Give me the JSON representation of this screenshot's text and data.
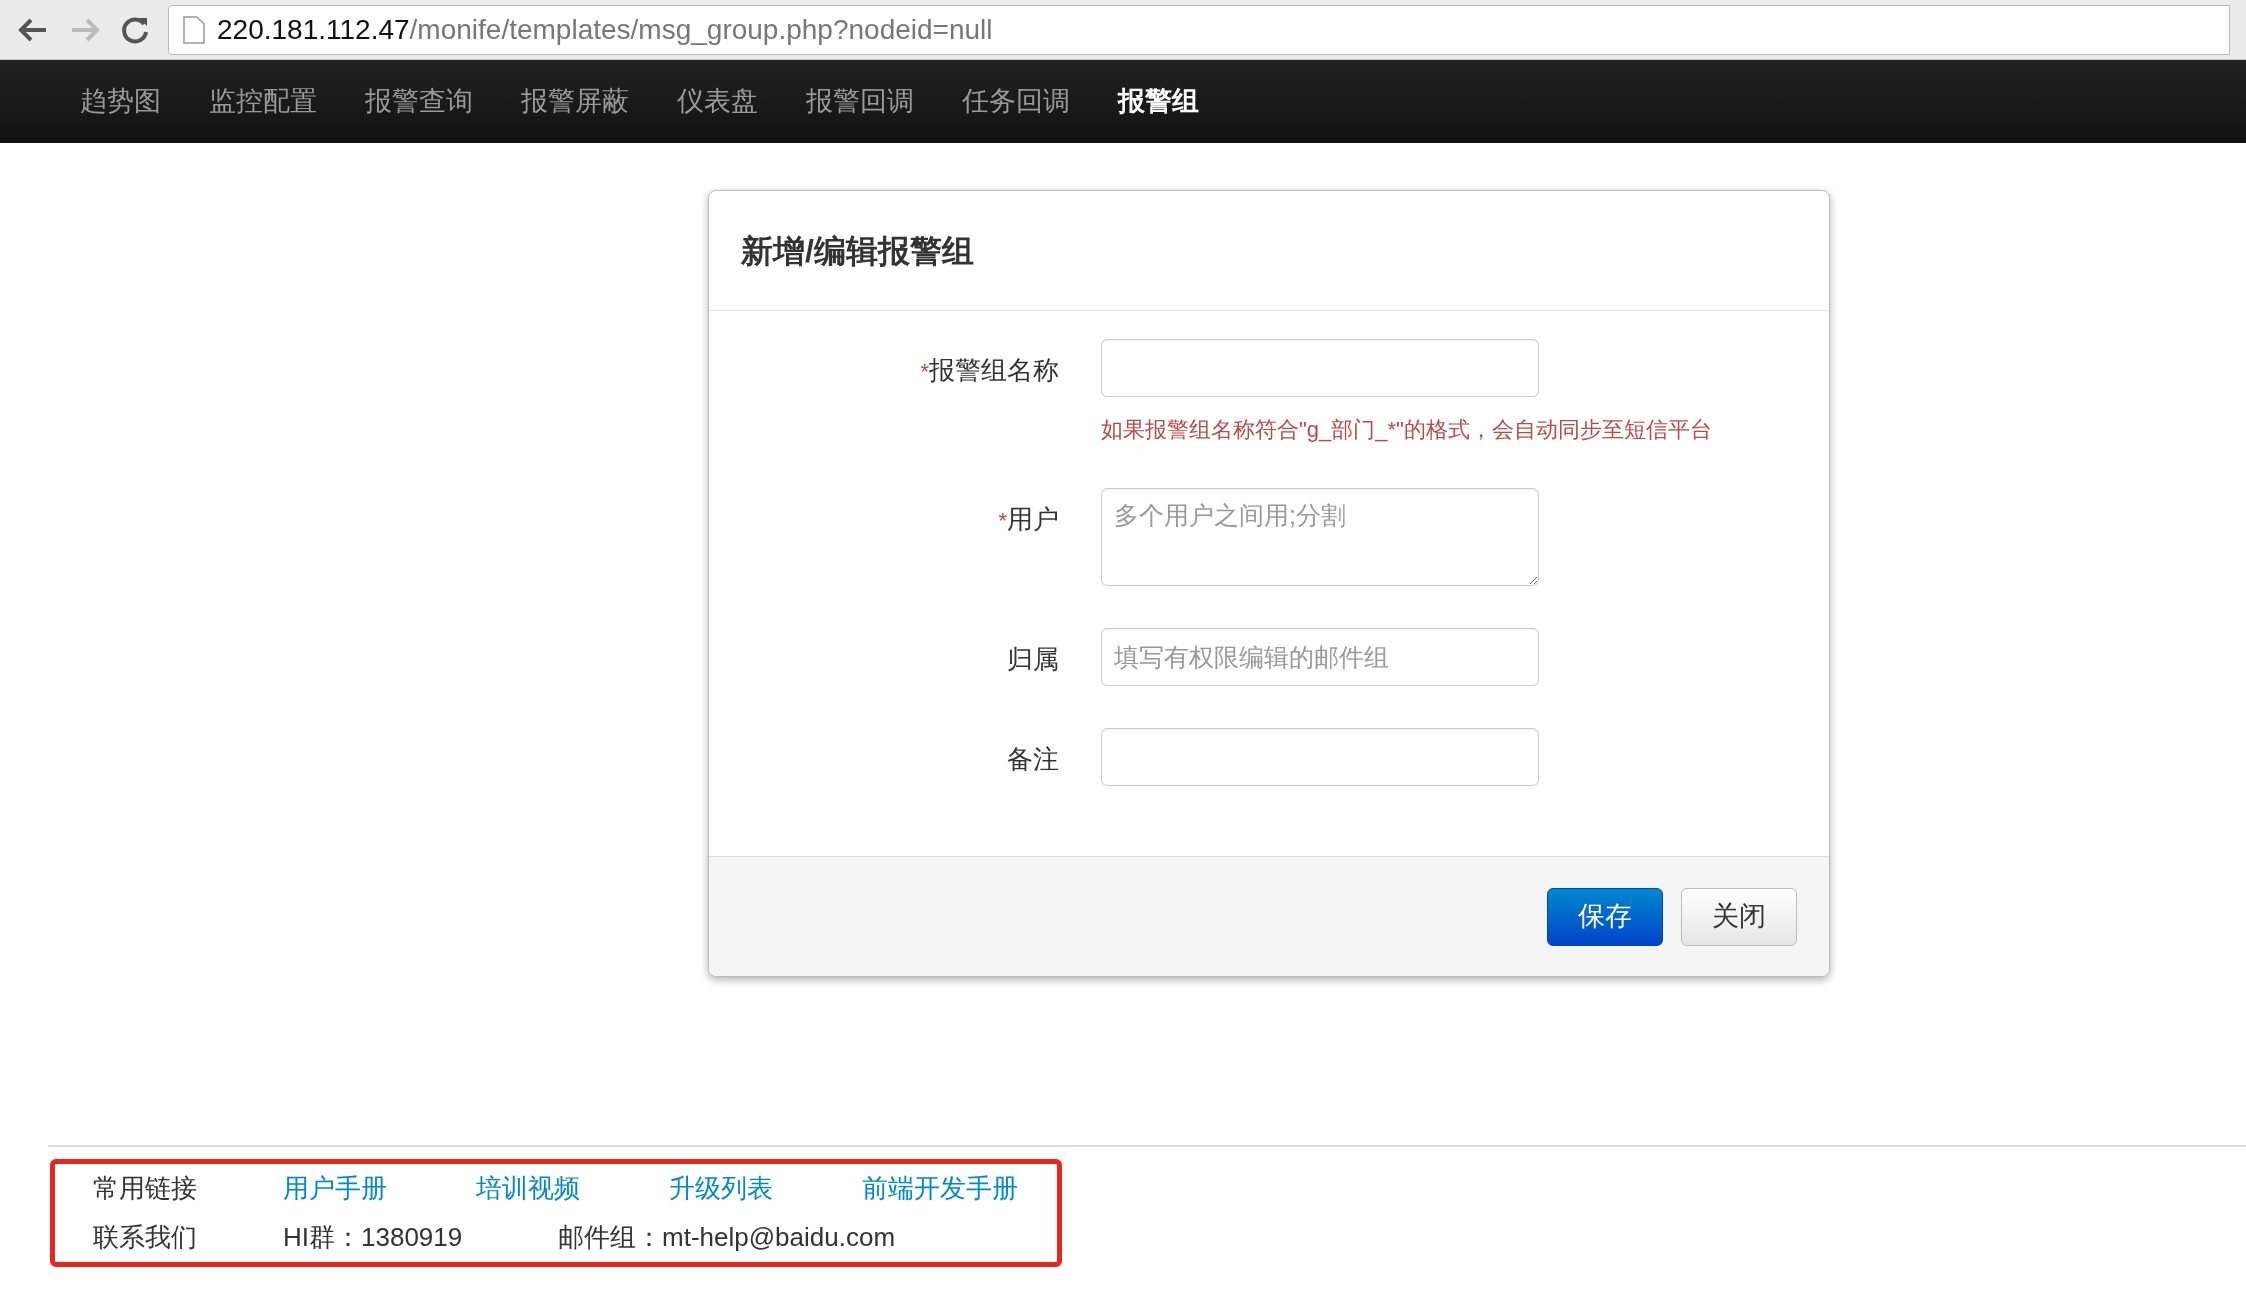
{
  "address_bar": {
    "host": "220.181.112.47",
    "path": "/monife/templates/msg_group.php?nodeid=null"
  },
  "nav": [
    {
      "label": "趋势图",
      "selected": false
    },
    {
      "label": "监控配置",
      "selected": false
    },
    {
      "label": "报警查询",
      "selected": false
    },
    {
      "label": "报警屏蔽",
      "selected": false
    },
    {
      "label": "仪表盘",
      "selected": false
    },
    {
      "label": "报警回调",
      "selected": false
    },
    {
      "label": "任务回调",
      "selected": false
    },
    {
      "label": "报警组",
      "selected": true
    }
  ],
  "dialog": {
    "title": "新增/编辑报警组",
    "fields": [
      {
        "kind": "input",
        "required_mark": "*",
        "label": "报警组名称",
        "help": "如果报警组名称符合\"g_部门_*\"的格式，会自动同步至短信平台"
      },
      {
        "kind": "textarea",
        "required_mark": "*",
        "label": "用户",
        "placeholder": "多个用户之间用;分割"
      },
      {
        "kind": "input",
        "label": "归属",
        "placeholder": "填写有权限编辑的邮件组"
      },
      {
        "kind": "input",
        "label": "备注"
      }
    ],
    "buttons": [
      {
        "label": "保存",
        "kind": "primary"
      },
      {
        "label": "关闭",
        "kind": "default"
      }
    ]
  },
  "footer": {
    "rows": [
      {
        "heading": "常用链接",
        "items": [
          {
            "kind": "link",
            "text": "用户手册"
          },
          {
            "kind": "link",
            "text": "培训视频"
          },
          {
            "kind": "link",
            "text": "升级列表"
          },
          {
            "kind": "link",
            "text": "前端开发手册"
          }
        ]
      },
      {
        "heading": "联系我们",
        "items": [
          {
            "kind": "text",
            "text": "HI群：1380919"
          },
          {
            "kind": "text",
            "text": "邮件组：mt-help@baidu.com"
          }
        ]
      }
    ]
  }
}
